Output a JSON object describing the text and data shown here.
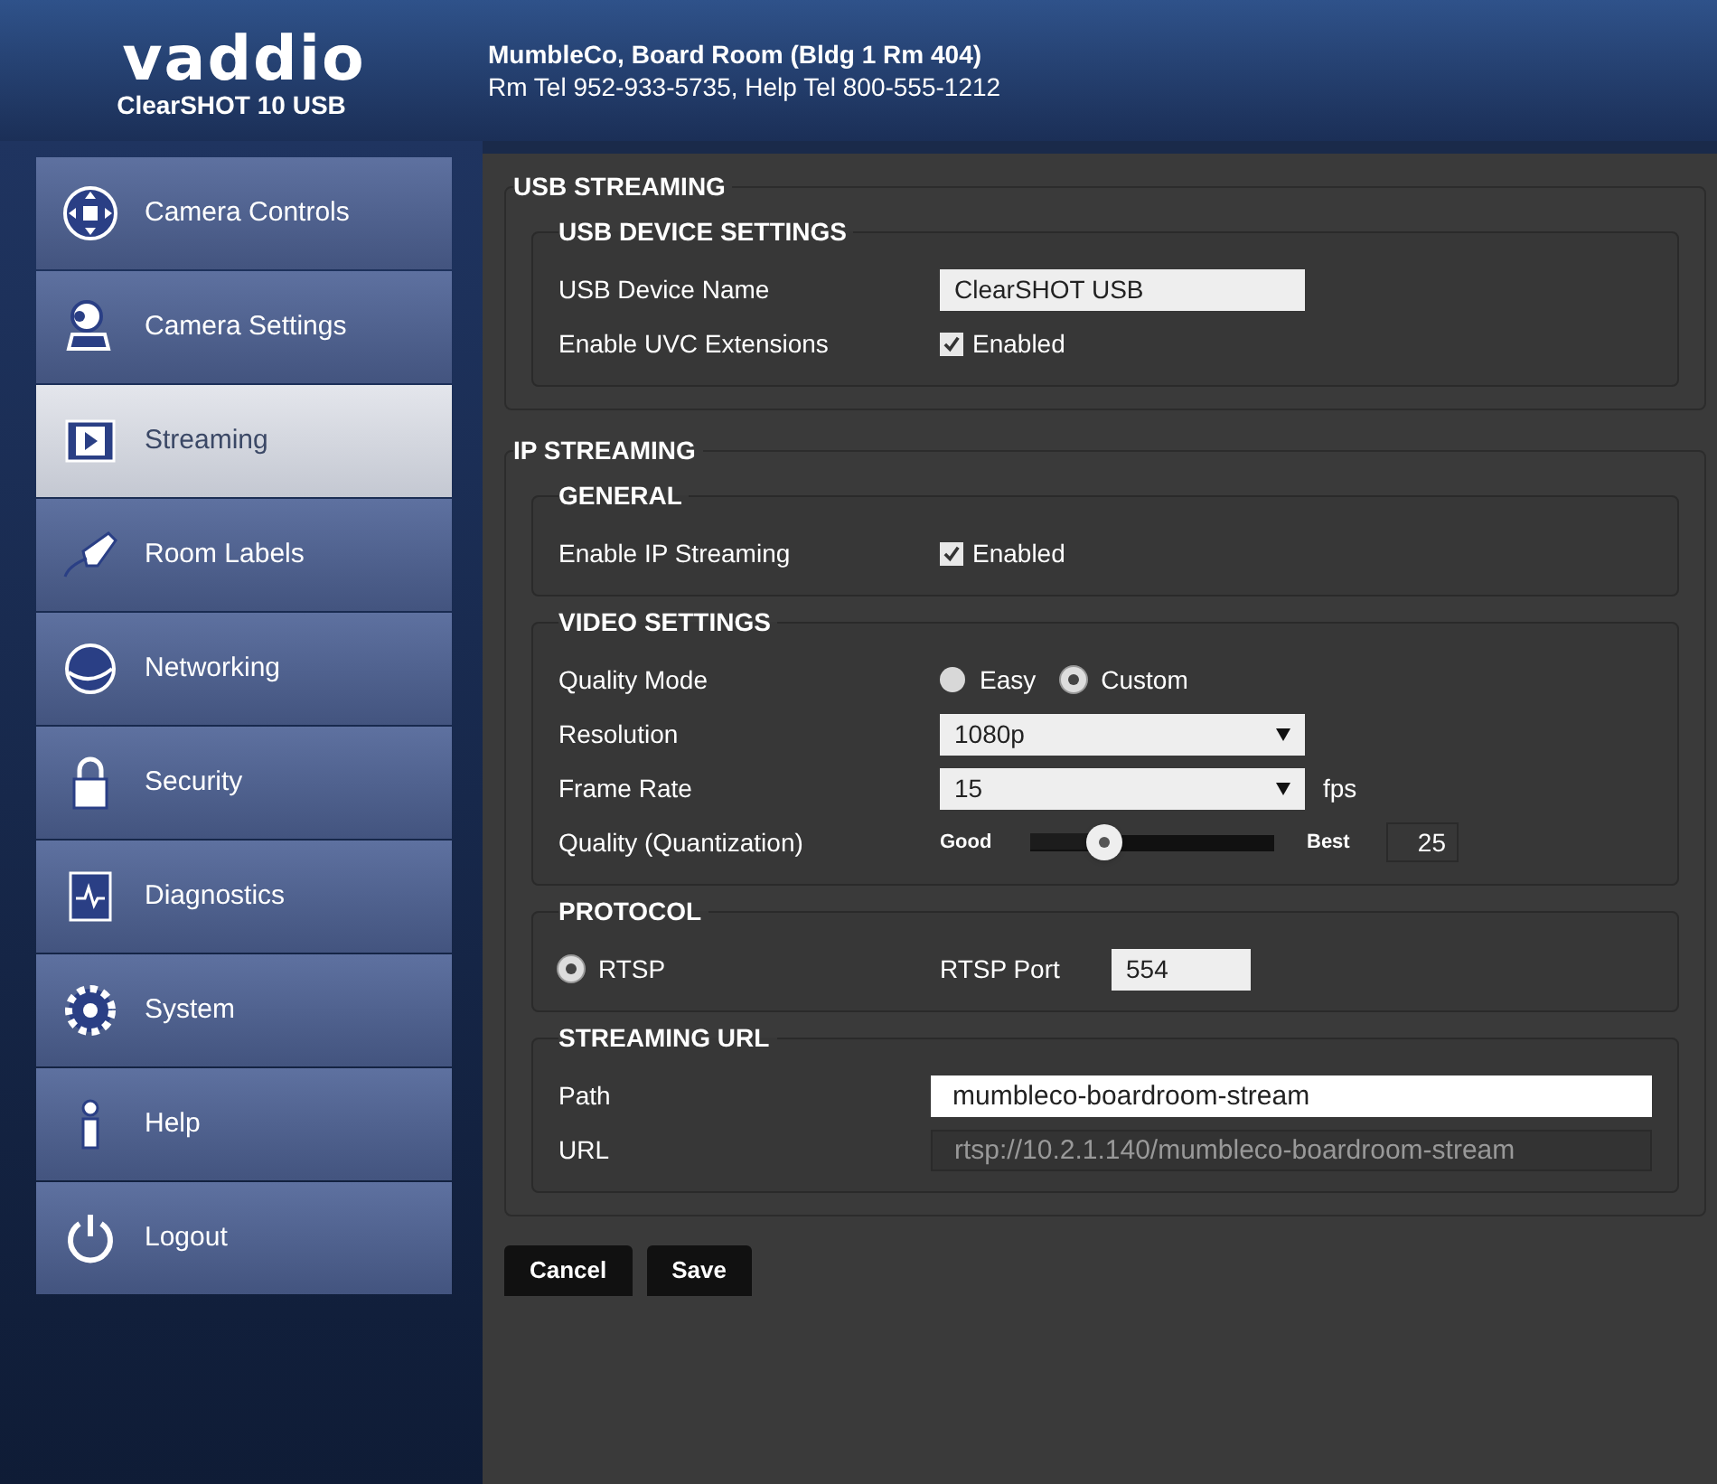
{
  "header": {
    "logo": "vaddio",
    "product": "ClearSHOT 10 USB",
    "location": "MumbleCo, Board Room (Bldg 1 Rm 404)",
    "phones": "Rm Tel 952-933-5735, Help Tel 800-555-1212"
  },
  "nav": [
    {
      "label": "Camera Controls",
      "selected": false
    },
    {
      "label": "Camera Settings",
      "selected": false
    },
    {
      "label": "Streaming",
      "selected": true
    },
    {
      "label": "Room Labels",
      "selected": false
    },
    {
      "label": "Networking",
      "selected": false
    },
    {
      "label": "Security",
      "selected": false
    },
    {
      "label": "Diagnostics",
      "selected": false
    },
    {
      "label": "System",
      "selected": false
    },
    {
      "label": "Help",
      "selected": false
    },
    {
      "label": "Logout",
      "selected": false
    }
  ],
  "sections": [
    {
      "title": "USB STREAMING",
      "groups": [
        {
          "title": "USB DEVICE SETTINGS",
          "rows": [
            {
              "kind": "text",
              "label": "USB Device Name",
              "value": "ClearSHOT USB"
            },
            {
              "kind": "checkbox",
              "label": "Enable UVC Extensions",
              "option": "Enabled",
              "checked": true
            }
          ]
        }
      ]
    },
    {
      "title": "IP STREAMING",
      "groups": [
        {
          "title": "GENERAL",
          "rows": [
            {
              "kind": "checkbox",
              "label": "Enable IP Streaming",
              "option": "Enabled",
              "checked": true
            }
          ]
        },
        {
          "title": "VIDEO SETTINGS",
          "rows": [
            {
              "kind": "radio",
              "label": "Quality Mode",
              "options": [
                {
                  "label": "Easy",
                  "selected": false
                },
                {
                  "label": "Custom",
                  "selected": true
                }
              ]
            },
            {
              "kind": "select",
              "label": "Resolution",
              "value": "1080p"
            },
            {
              "kind": "select",
              "label": "Frame Rate",
              "value": "15",
              "unit": "fps"
            },
            {
              "kind": "slider",
              "label": "Quality (Quantization)",
              "min_label": "Good",
              "max_label": "Best",
              "level": 0.3,
              "reading": "25"
            }
          ]
        },
        {
          "title": "PROTOCOL",
          "rows": [
            {
              "kind": "protocol",
              "option": "RTSP",
              "selected": true,
              "port_label": "RTSP Port",
              "port": "554"
            }
          ]
        },
        {
          "title": "STREAMING URL",
          "rows": [
            {
              "kind": "wide",
              "label": "Path",
              "value": "mumbleco-boardroom-stream"
            },
            {
              "kind": "readonly",
              "label": "URL",
              "value": "rtsp://10.2.1.140/mumbleco-boardroom-stream"
            }
          ]
        }
      ]
    }
  ],
  "buttons": [
    "Cancel",
    "Save"
  ]
}
